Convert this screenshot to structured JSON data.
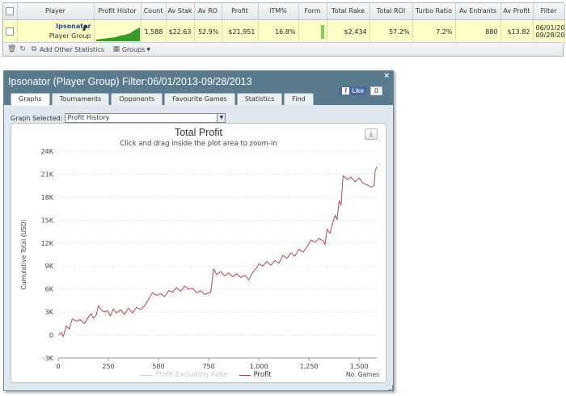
{
  "stats_table": {
    "headers": [
      "Player",
      "Profit Histor",
      "Count",
      "Av Stak",
      "Av RO",
      "Profit",
      "ITM%",
      "Form",
      "Total Rake",
      "Total ROI",
      "Turbo Ratio",
      "Av Entrants",
      "Av Profit",
      "Filter"
    ],
    "row": {
      "player_name": "Ipsonator",
      "player_group": "Player Group",
      "count": "1,588",
      "av_stake": "$22.63",
      "av_roi": "52.9%",
      "profit": "$21,951",
      "itm": "16.8%",
      "total_rake": "$2,434",
      "total_roi": "57.2%",
      "turbo_ratio": "7.2%",
      "av_entrants": "880",
      "av_profit": "$13.82",
      "filter_line1": "06/01/20",
      "filter_line2": "09/28/20"
    },
    "colors": {
      "row_bg": "#ffffc8",
      "sparkline": "#3a9a2e",
      "form_bar": "#7fcf5c"
    },
    "icons": [
      "rider-icon",
      "trash-icon",
      "refresh-icon",
      "copy-icon",
      "groups-icon"
    ]
  },
  "toolbar": {
    "add_stats_label": "Add Other Statistics",
    "groups_label": "Groups"
  },
  "dialog": {
    "title": "Ipsonator (Player Group) Filter:06/01/2013-09/28/2013",
    "close_label": "×",
    "fb_like_label": "Like",
    "fb_like_count": "0",
    "tabs": [
      "Graphs",
      "Tournaments",
      "Opponents",
      "Favourite Games",
      "Statistics",
      "Find"
    ],
    "active_tab": "Graphs",
    "graph_selected_label": "Graph Selected:",
    "graph_selected_value": "Profit History"
  },
  "chart_data": {
    "type": "line",
    "title": "Total Profit",
    "subtitle": "Click and drag inside the plot area to zoom-in",
    "xlabel": "No. Games",
    "ylabel": "Cumulative Total (USD)",
    "xlim": [
      0,
      1588
    ],
    "ylim": [
      -3000,
      24000
    ],
    "x_ticks": [
      0,
      250,
      500,
      750,
      1000,
      1250,
      1500
    ],
    "x_tick_labels": [
      "0",
      "250",
      "500",
      "750",
      "1,000",
      "1,250",
      "1,500"
    ],
    "y_ticks": [
      -3000,
      0,
      3000,
      6000,
      9000,
      12000,
      15000,
      18000,
      21000,
      24000
    ],
    "y_tick_labels": [
      "-3K",
      "0",
      "3K",
      "6K",
      "9K",
      "12K",
      "15K",
      "18K",
      "21K",
      "24K"
    ],
    "grid": true,
    "legend_position": "bottom",
    "series": [
      {
        "name": "Profit Excluding Rake",
        "visible": false,
        "color": "#cccccc",
        "x": [],
        "y": []
      },
      {
        "name": "Profit",
        "visible": true,
        "color": "#b04848",
        "x": [
          0,
          15,
          25,
          40,
          55,
          70,
          90,
          110,
          130,
          150,
          165,
          175,
          190,
          200,
          215,
          230,
          245,
          260,
          275,
          290,
          310,
          330,
          350,
          370,
          390,
          410,
          430,
          450,
          460,
          470,
          490,
          510,
          530,
          550,
          570,
          590,
          610,
          630,
          650,
          670,
          690,
          710,
          730,
          760,
          775,
          790,
          810,
          830,
          850,
          870,
          890,
          910,
          930,
          950,
          970,
          990,
          1000,
          1020,
          1040,
          1060,
          1080,
          1100,
          1120,
          1140,
          1160,
          1180,
          1200,
          1220,
          1240,
          1260,
          1280,
          1300,
          1320,
          1330,
          1340,
          1355,
          1370,
          1380,
          1390,
          1400,
          1410,
          1420,
          1440,
          1460,
          1480,
          1500,
          1520,
          1540,
          1560,
          1575,
          1580,
          1588
        ],
        "y": [
          0,
          300,
          -200,
          1200,
          800,
          2100,
          1800,
          2000,
          1500,
          2300,
          2800,
          2200,
          2600,
          3800,
          3300,
          3000,
          3200,
          2500,
          3400,
          2900,
          3300,
          2700,
          3500,
          2900,
          3600,
          3300,
          3800,
          4600,
          5100,
          5500,
          5200,
          5400,
          5000,
          5800,
          5600,
          6200,
          5700,
          6400,
          6000,
          6100,
          5500,
          5800,
          5300,
          5600,
          8600,
          7900,
          8300,
          7700,
          8100,
          7600,
          8000,
          7500,
          7800,
          7200,
          8200,
          8800,
          9300,
          9000,
          9600,
          9100,
          9700,
          9400,
          10400,
          10000,
          10700,
          10300,
          11200,
          10800,
          11500,
          12400,
          12100,
          12600,
          12300,
          11800,
          13800,
          13300,
          14800,
          15600,
          15100,
          17500,
          17000,
          20800,
          20300,
          20600,
          20000,
          20500,
          19800,
          19600,
          19300,
          19500,
          21400,
          21951
        ]
      }
    ]
  }
}
